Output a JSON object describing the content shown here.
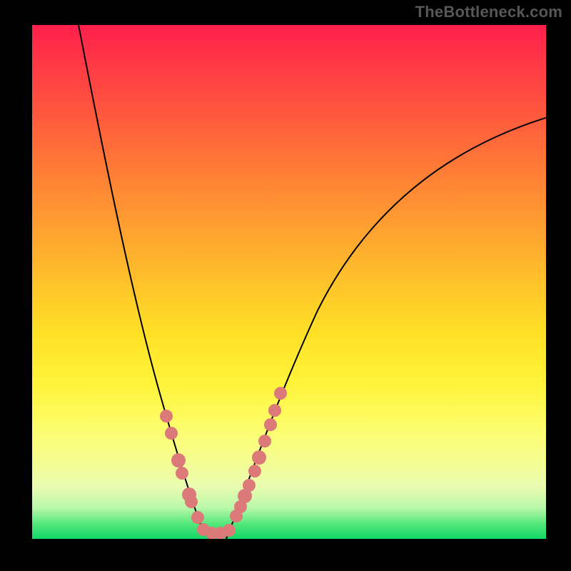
{
  "watermark": "TheBottleneck.com",
  "chart_data": {
    "type": "line",
    "title": "",
    "xlabel": "",
    "ylabel": "",
    "xlim": [
      0,
      100
    ],
    "ylim": [
      0,
      100
    ],
    "grid": false,
    "legend": false,
    "background_gradient": {
      "direction": "vertical",
      "stops": [
        {
          "pos": 0,
          "color": "#ff1f4c"
        },
        {
          "pos": 50,
          "color": "#ffc22a"
        },
        {
          "pos": 80,
          "color": "#fdfd6a"
        },
        {
          "pos": 100,
          "color": "#0fd766"
        }
      ]
    },
    "series": [
      {
        "name": "bottleneck-curve",
        "color": "#000000",
        "x": [
          9,
          14,
          19,
          25,
          30,
          33,
          35,
          38,
          42,
          47,
          55,
          70,
          100
        ],
        "values": [
          100,
          75,
          47,
          27,
          10,
          3,
          0,
          3,
          12,
          28,
          46,
          68,
          82
        ]
      }
    ],
    "points": {
      "name": "highlighted-range",
      "color": "#dc7a7a",
      "x": [
        26,
        27,
        28,
        29,
        30,
        31,
        32,
        33,
        35,
        37,
        38,
        40,
        41,
        42,
        43,
        44,
        45,
        46,
        47,
        48
      ],
      "values": [
        24,
        21,
        15,
        13,
        9,
        7,
        4,
        2,
        1,
        1,
        2,
        5,
        6,
        8,
        10,
        13,
        16,
        19,
        22,
        25
      ]
    }
  }
}
